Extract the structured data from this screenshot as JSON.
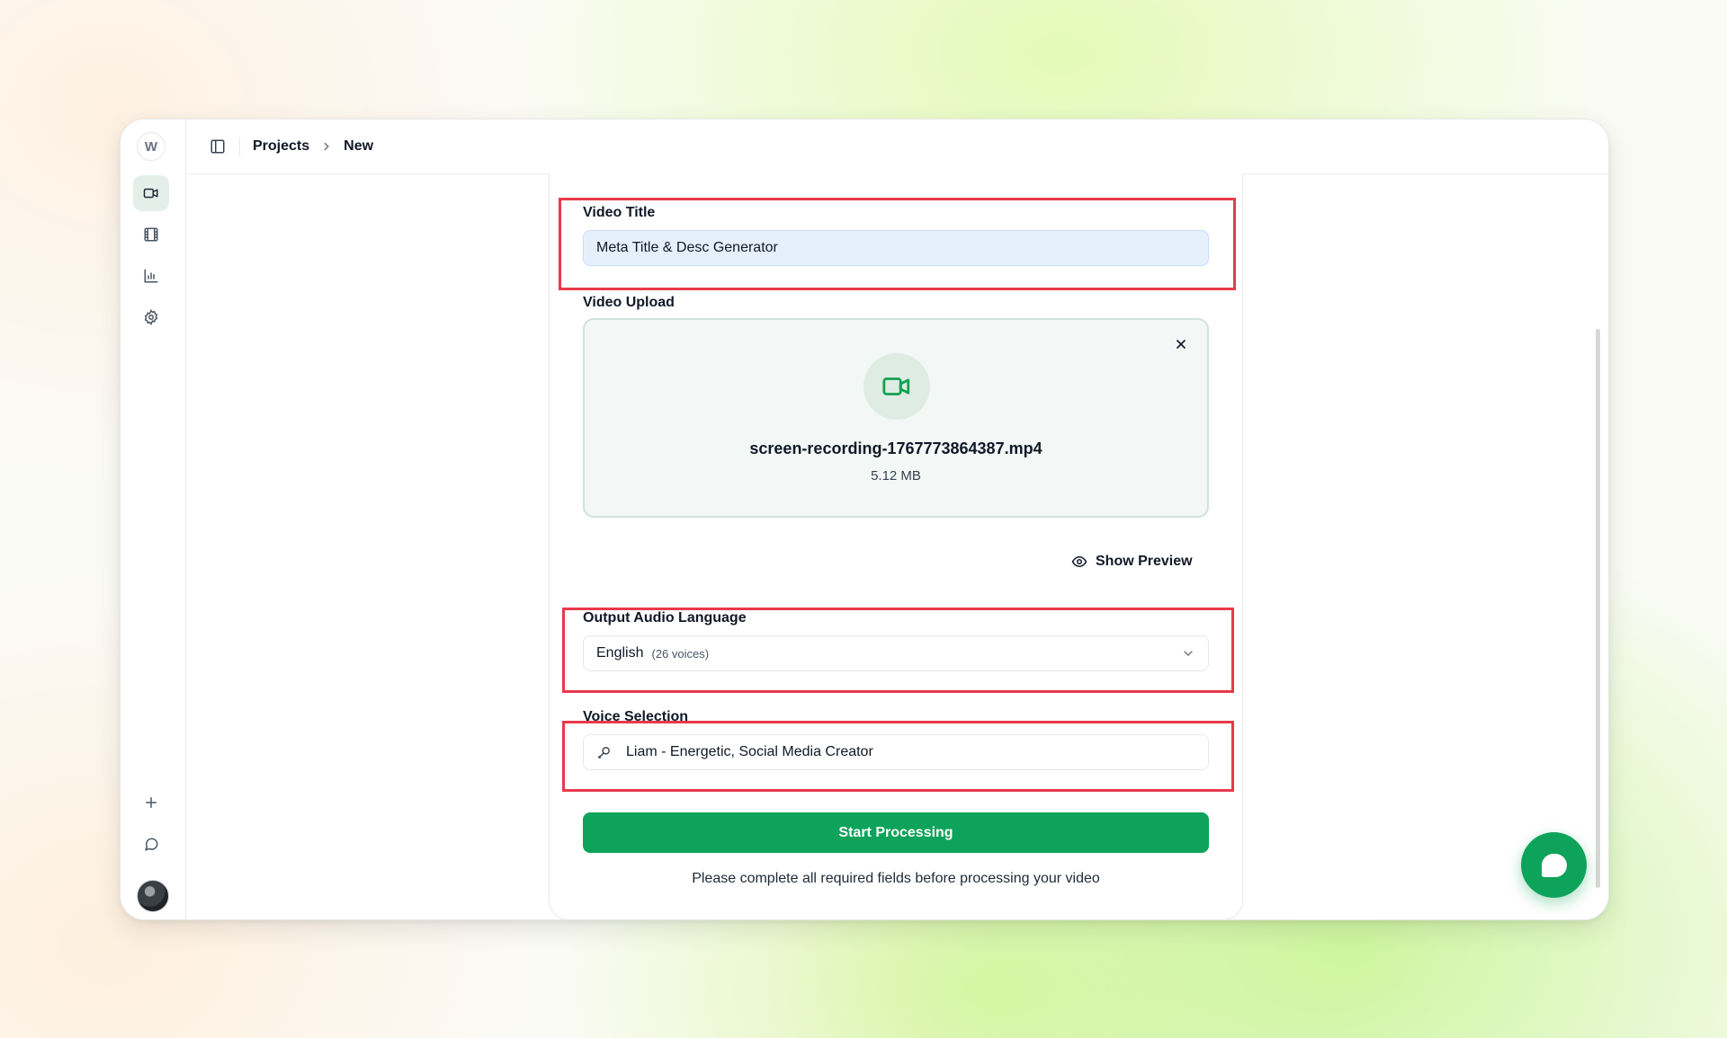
{
  "app": {
    "logo_letter": "W"
  },
  "sidebar": {
    "items": [
      {
        "name": "videos",
        "icon": "video-camera-icon",
        "active": true
      },
      {
        "name": "library",
        "icon": "film-icon",
        "active": false
      },
      {
        "name": "analytics",
        "icon": "bar-chart-icon",
        "active": false
      },
      {
        "name": "settings",
        "icon": "gear-icon",
        "active": false
      }
    ],
    "bottom": [
      {
        "name": "new",
        "icon": "plus-icon"
      },
      {
        "name": "chat",
        "icon": "message-icon"
      },
      {
        "name": "profile",
        "icon": "avatar"
      }
    ]
  },
  "breadcrumb": {
    "projects": "Projects",
    "current": "New"
  },
  "form": {
    "title_label": "Video Title",
    "title_value": "Meta Title & Desc Generator",
    "upload_label": "Video Upload",
    "file_name": "screen-recording-1767773864387.mp4",
    "file_size": "5.12 MB",
    "preview_label": "Show Preview",
    "language_label": "Output Audio Language",
    "language_value": "English",
    "language_voices": "(26 voices)",
    "voice_label": "Voice Selection",
    "voice_value": "Liam - Energetic, Social Media Creator",
    "submit_label": "Start Processing",
    "helper_text": "Please complete all required fields before processing your video"
  },
  "colors": {
    "accent_green": "#0ea35a",
    "highlight_red": "#e8394b",
    "input_blue": "#e6f0fd"
  }
}
